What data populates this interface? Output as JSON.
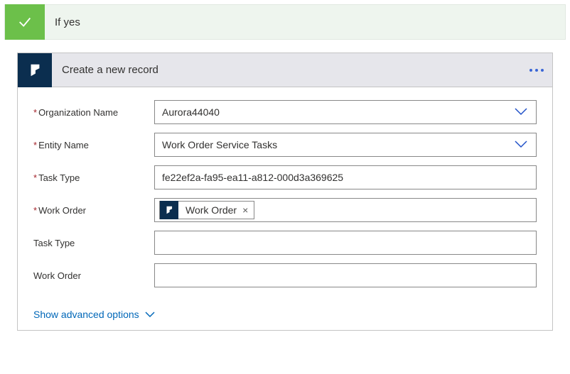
{
  "condition": {
    "title": "If yes"
  },
  "card": {
    "title": "Create a new record"
  },
  "fields": {
    "orgName": {
      "label": "Organization Name",
      "required": true,
      "value": "Aurora44040"
    },
    "entityName": {
      "label": "Entity Name",
      "required": true,
      "value": "Work Order Service Tasks"
    },
    "taskTypeReq": {
      "label": "Task Type",
      "required": true,
      "value": "fe22ef2a-fa95-ea11-a812-000d3a369625"
    },
    "workOrderReq": {
      "label": "Work Order",
      "required": true,
      "tokenLabel": "Work Order"
    },
    "taskType": {
      "label": "Task Type",
      "required": false,
      "value": ""
    },
    "workOrder": {
      "label": "Work Order",
      "required": false,
      "value": ""
    }
  },
  "links": {
    "advancedOptions": "Show advanced options"
  }
}
